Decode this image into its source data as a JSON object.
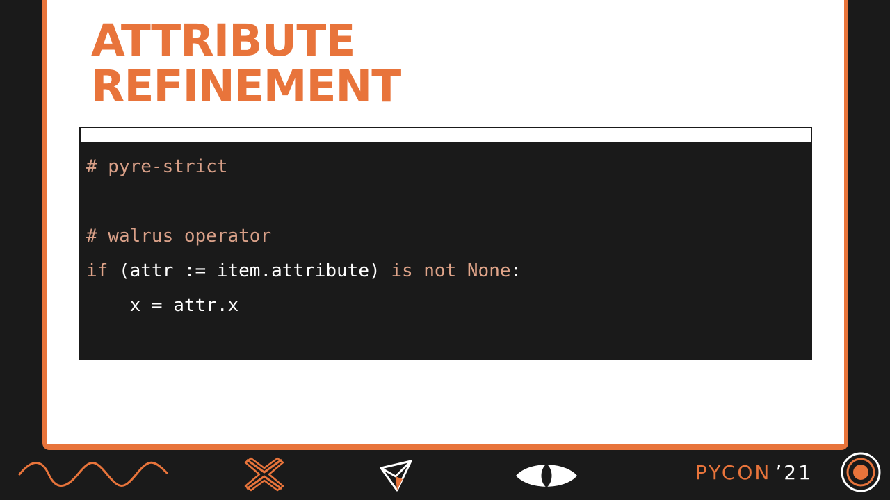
{
  "slide": {
    "title_line1": "ATTRIBUTE",
    "title_line2": "REFINEMENT"
  },
  "code": {
    "line1_comment": "# pyre-strict",
    "line2": "",
    "line3_comment": "# walrus operator",
    "line4": {
      "kw_if": "if",
      "part1": " (attr := item.attribute) ",
      "kw_is_not": "is not",
      "space": " ",
      "const_none": "None",
      "colon": ":"
    },
    "line5": {
      "indent": "    ",
      "text": "x = attr.x"
    }
  },
  "footer": {
    "brand_name": "PYCON",
    "brand_year": "’21",
    "icons": [
      "wave-icon",
      "x-mark-icon",
      "paper-plane-icon",
      "eye-icon",
      "target-icon"
    ]
  },
  "colors": {
    "accent": "#e8743b",
    "background": "#1a1a1a",
    "slide": "#ffffff",
    "code_comment": "#d9a088",
    "code_keyword": "#e1a58a"
  }
}
